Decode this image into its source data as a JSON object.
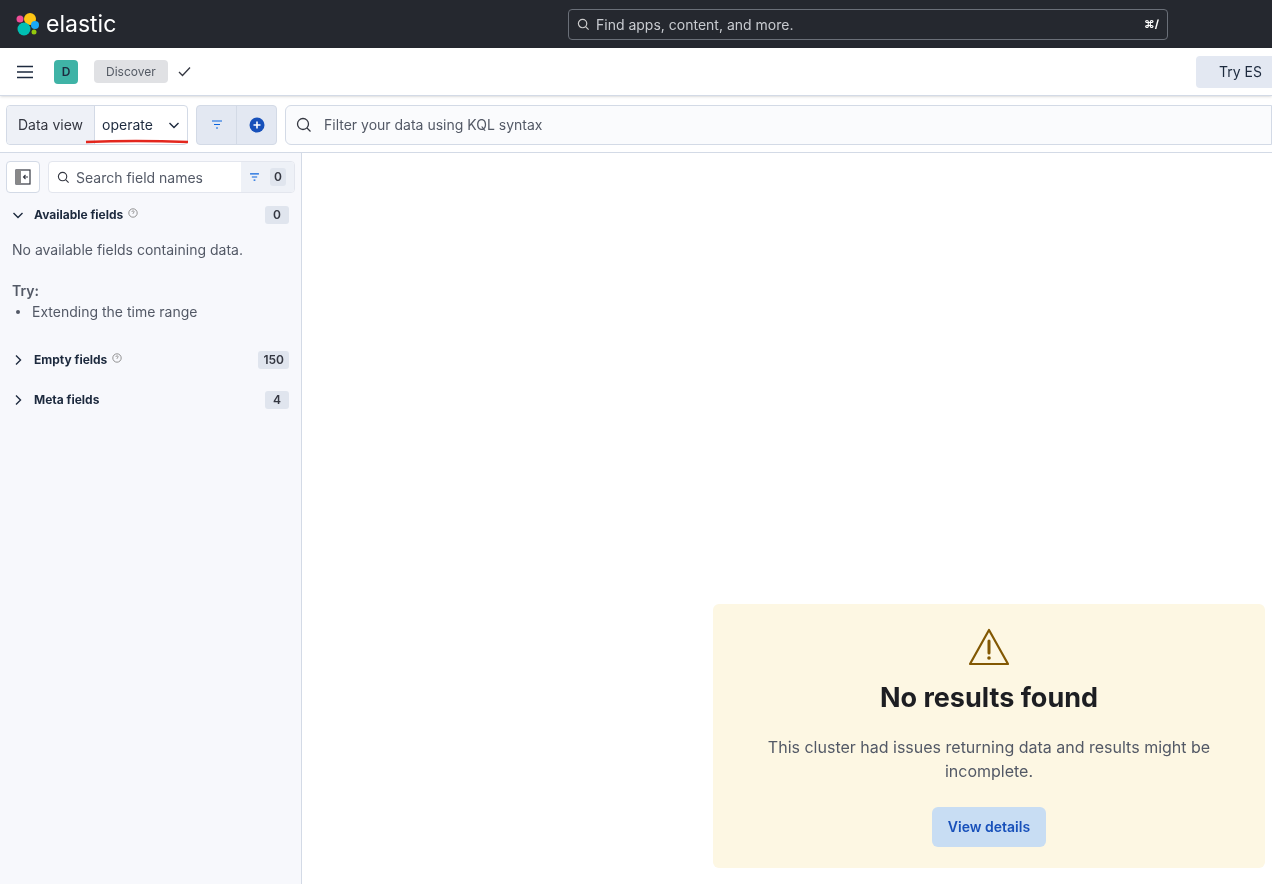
{
  "header": {
    "logo_text": "elastic",
    "search": {
      "placeholder": "Find apps, content, and more.",
      "shortcut": "⌘/"
    }
  },
  "breadcrumbs": {
    "space_initial": "D",
    "items": [
      {
        "label": "Discover"
      }
    ],
    "try_button": "Try ES"
  },
  "query_bar": {
    "data_view_label": "Data view",
    "data_view_value": "operate",
    "filter_placeholder": "Filter your data using KQL syntax"
  },
  "sidebar": {
    "search": {
      "placeholder": "Search field names",
      "filter_count": "0"
    },
    "sections": [
      {
        "title": "Available fields",
        "count": "0",
        "expanded": true,
        "help": true,
        "empty_message": "No available fields containing data.",
        "try_label": "Try:",
        "suggestions": [
          "Extending the time range"
        ]
      },
      {
        "title": "Empty fields",
        "count": "150",
        "expanded": false,
        "help": true
      },
      {
        "title": "Meta fields",
        "count": "4",
        "expanded": false,
        "help": false
      }
    ]
  },
  "callout": {
    "title": "No results found",
    "body": "This cluster had issues returning data and results might be incomplete.",
    "button": "View details"
  }
}
